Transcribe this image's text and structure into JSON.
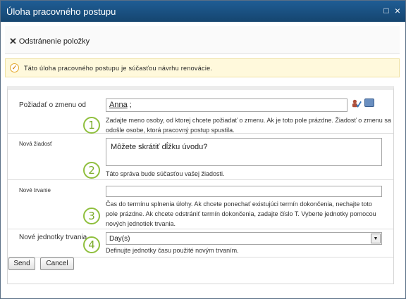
{
  "window": {
    "title": "Úloha pracovného postupu",
    "maximize_glyph": "□",
    "close_glyph": "×"
  },
  "ribbon": {
    "icon": "x-icon",
    "action_label": "Odstránenie položky"
  },
  "notice": {
    "icon": "check-circle-icon",
    "text": "Táto úloha pracovného postupu je súčasťou návrhu renovácie."
  },
  "form": {
    "request_change_from": {
      "label": "Požiadať o zmenu od",
      "value": "Anna",
      "separator": ";",
      "description": "Zadajte meno osoby, od ktorej chcete požiadať o zmenu. Ak je toto pole prázdne. Žiadosť o zmenu sa odošle osobe, ktorá pracovný postup spustila.",
      "step": "1"
    },
    "new_request": {
      "label": "Nová žiadosť",
      "value": "Môžete skrátiť dĺžku úvodu?",
      "description": "Táto správa bude súčasťou vašej žiadosti.",
      "step": "2"
    },
    "new_duration": {
      "label": "Nové trvanie",
      "value": "",
      "description": "Čas do termínu splnenia úlohy. Ak chcete ponechať existujúci termín dokončenia, nechajte toto pole prázdne. Ak chcete odstrániť termín dokončenia, zadajte číslo T. Vyberte jednotky pomocou nových jednotiek trvania.",
      "step": "3"
    },
    "new_duration_units": {
      "label": "Nové jednotky trvania",
      "selected": "Day(s)",
      "description": "Definujte jednotky času použité novým trvaním.",
      "step": "4"
    }
  },
  "buttons": {
    "send": "Send",
    "cancel": "Cancel"
  },
  "colors": {
    "titlebar": "#1a5288",
    "notice_bg": "#fff9dc",
    "step_ring": "#8fbf3d"
  }
}
